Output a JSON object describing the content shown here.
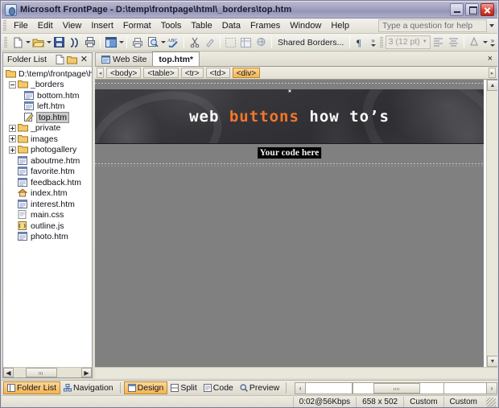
{
  "window": {
    "title": "Microsoft FrontPage - D:\\temp\\frontpage\\html\\_borders\\top.htm",
    "icon": "frontpage-icon",
    "minimize_label": "Minimize",
    "maximize_label": "Maximize",
    "close_label": "Close"
  },
  "menubar": {
    "items": [
      {
        "label": "File"
      },
      {
        "label": "Edit"
      },
      {
        "label": "View"
      },
      {
        "label": "Insert"
      },
      {
        "label": "Format"
      },
      {
        "label": "Tools"
      },
      {
        "label": "Table"
      },
      {
        "label": "Data"
      },
      {
        "label": "Frames"
      },
      {
        "label": "Window"
      },
      {
        "label": "Help"
      }
    ],
    "help_question_placeholder": "Type a question for help"
  },
  "toolbar": {
    "shared_borders_label": "Shared Borders...",
    "font_size_value": "3 (12 pt)",
    "buttons": [
      {
        "name": "new-page-icon"
      },
      {
        "name": "open-icon"
      },
      {
        "name": "save-icon"
      },
      {
        "name": "search-icon"
      },
      {
        "name": "publish-icon"
      },
      {
        "name": "toggle-pane-icon"
      },
      {
        "name": "print-icon"
      },
      {
        "name": "print-preview-icon"
      },
      {
        "name": "spelling-icon"
      },
      {
        "name": "cut-icon"
      },
      {
        "name": "format-painter-icon"
      },
      {
        "name": "insert-layer-icon"
      },
      {
        "name": "insert-table-icon"
      },
      {
        "name": "hyperlink-icon"
      },
      {
        "name": "show-marks-icon"
      },
      {
        "name": "align-left-icon"
      },
      {
        "name": "align-center-icon"
      },
      {
        "name": "font-color-icon"
      }
    ]
  },
  "folder_list": {
    "title": "Folder List",
    "new_page_icon": "new-page-icon",
    "new_folder_icon": "new-folder-icon",
    "close_icon": "close-icon",
    "tree": [
      {
        "label": "D:\\temp\\frontpage\\html",
        "icon": "folder-icon",
        "indent": 0,
        "toggle": "none",
        "selected": false
      },
      {
        "label": "_borders",
        "icon": "folder-icon",
        "indent": 1,
        "toggle": "minus",
        "selected": false
      },
      {
        "label": "bottom.htm",
        "icon": "html-page-icon",
        "indent": 3,
        "toggle": "none",
        "selected": false
      },
      {
        "label": "left.htm",
        "icon": "html-page-icon",
        "indent": 3,
        "toggle": "none",
        "selected": false
      },
      {
        "label": "top.htm",
        "icon": "html-page-edit-icon",
        "indent": 3,
        "toggle": "none",
        "selected": true
      },
      {
        "label": "_private",
        "icon": "folder-icon",
        "indent": 1,
        "toggle": "plus",
        "selected": false
      },
      {
        "label": "images",
        "icon": "folder-icon",
        "indent": 1,
        "toggle": "plus",
        "selected": false
      },
      {
        "label": "photogallery",
        "icon": "folder-icon",
        "indent": 1,
        "toggle": "plus",
        "selected": false
      },
      {
        "label": "aboutme.htm",
        "icon": "html-page-icon",
        "indent": 2,
        "toggle": "none",
        "selected": false
      },
      {
        "label": "favorite.htm",
        "icon": "html-page-icon",
        "indent": 2,
        "toggle": "none",
        "selected": false
      },
      {
        "label": "feedback.htm",
        "icon": "html-page-icon",
        "indent": 2,
        "toggle": "none",
        "selected": false
      },
      {
        "label": "index.htm",
        "icon": "home-page-icon",
        "indent": 2,
        "toggle": "none",
        "selected": false
      },
      {
        "label": "interest.htm",
        "icon": "html-page-icon",
        "indent": 2,
        "toggle": "none",
        "selected": false
      },
      {
        "label": "main.css",
        "icon": "css-file-icon",
        "indent": 2,
        "toggle": "none",
        "selected": false
      },
      {
        "label": "outline.js",
        "icon": "script-file-icon",
        "indent": 2,
        "toggle": "none",
        "selected": false
      },
      {
        "label": "photo.htm",
        "icon": "html-page-icon",
        "indent": 2,
        "toggle": "none",
        "selected": false
      }
    ]
  },
  "doc_tabs": {
    "tabs": [
      {
        "label": "Web Site",
        "icon": "web-site-icon",
        "active": false
      },
      {
        "label": "top.htm*",
        "icon": "",
        "active": true
      }
    ],
    "close_label": "×"
  },
  "tag_strip": {
    "left_scroll": "◂",
    "right_scroll": "▸",
    "tags": [
      {
        "label": "<body>",
        "active": false
      },
      {
        "label": "<table>",
        "active": false
      },
      {
        "label": "<tr>",
        "active": false
      },
      {
        "label": "<td>",
        "active": false
      },
      {
        "label": "<div>",
        "active": true
      }
    ]
  },
  "canvas": {
    "banner": {
      "text_before": "web ",
      "text_highlight": "buttons",
      "text_after": " how to’s",
      "highlight_color": "#f2762a",
      "background_color": "#34343a"
    },
    "code_placeholder": "Your code here",
    "selection_handle": "selection-handle"
  },
  "view_bar": {
    "pane_buttons": [
      {
        "label": "Folder List",
        "icon": "folder-list-icon",
        "active": true
      },
      {
        "label": "Navigation",
        "icon": "navigation-icon",
        "active": false
      }
    ],
    "view_buttons": [
      {
        "label": "Design",
        "icon": "design-view-icon",
        "active": true
      },
      {
        "label": "Split",
        "icon": "split-view-icon",
        "active": false
      },
      {
        "label": "Code",
        "icon": "code-view-icon",
        "active": false
      },
      {
        "label": "Preview",
        "icon": "preview-view-icon",
        "active": false
      }
    ],
    "scroll_left": "‹",
    "scroll_right": "›"
  },
  "status_bar": {
    "download_time": "0:02@56Kbps",
    "page_size": "658 x 502",
    "schema": "Custom",
    "css_schema": "Custom"
  }
}
